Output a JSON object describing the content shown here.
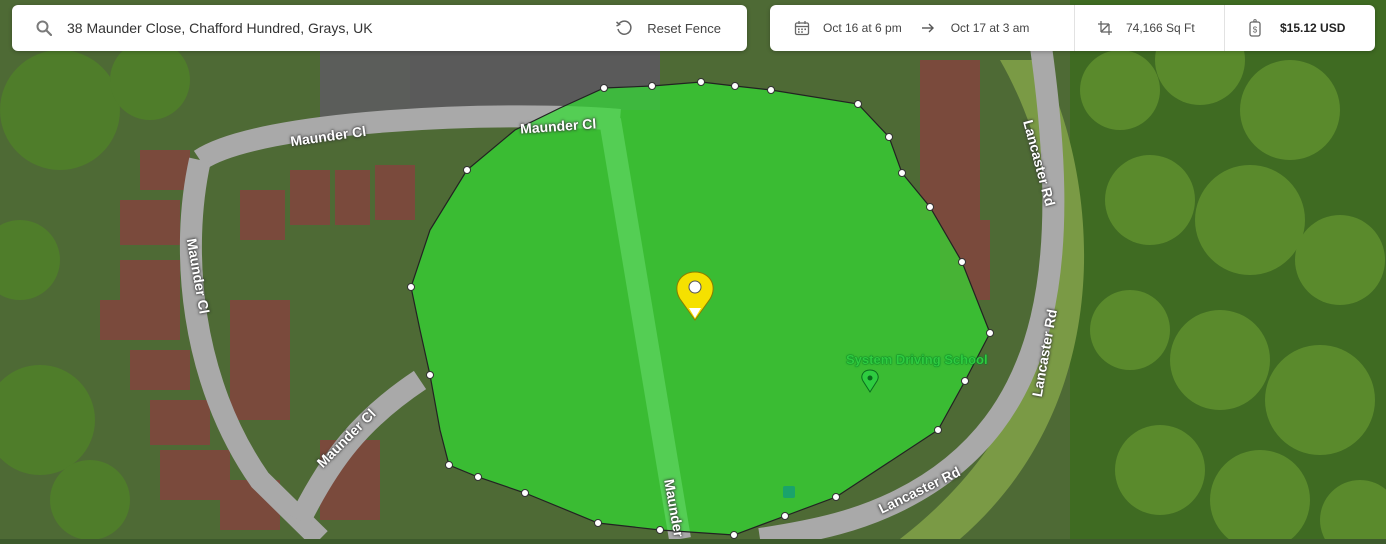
{
  "search": {
    "address": "38 Maunder Close, Chafford Hundred, Grays, UK",
    "reset_label": "Reset Fence"
  },
  "info": {
    "start_date": "Oct 16 at 6 pm",
    "end_date": "Oct 17 at 3 am",
    "area": "74,166 Sq Ft",
    "price": "$15.12 USD"
  },
  "map": {
    "road_labels": [
      "Maunder Cl",
      "Maunder Cl",
      "Maunder Cl",
      "Maunder Cl",
      "Lancaster Rd",
      "Lancaster Rd",
      "Lancaster Rd",
      "Maunder"
    ],
    "poi_label": "System Driving School",
    "fence_color": "#3dd83a",
    "pin_color": "#f5e100"
  }
}
